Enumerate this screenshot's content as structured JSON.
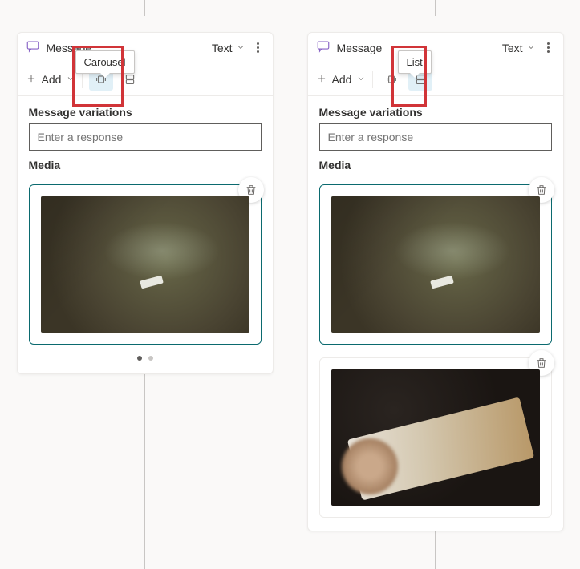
{
  "left": {
    "title": "Message",
    "tooltip": "Carousel",
    "typeLabel": "Text",
    "addLabel": "Add",
    "sectionLabel": "Message variations",
    "placeholder": "Enter a response",
    "mediaLabel": "Media"
  },
  "right": {
    "title": "Message",
    "tooltip": "List",
    "typeLabel": "Text",
    "addLabel": "Add",
    "sectionLabel": "Message variations",
    "placeholder": "Enter a response",
    "mediaLabel": "Media"
  }
}
